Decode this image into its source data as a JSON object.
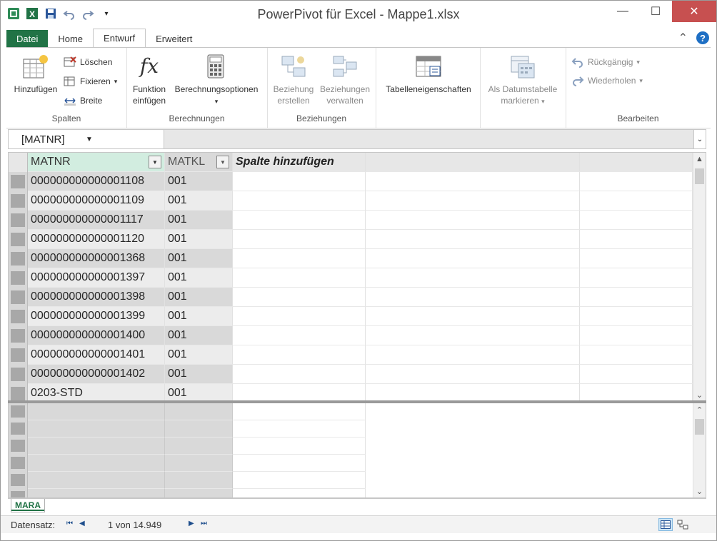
{
  "window": {
    "title": "PowerPivot für Excel - Mappe1.xlsx",
    "minimize": "—",
    "maximize": "☐",
    "close": "✕"
  },
  "ribbon": {
    "tabs": [
      {
        "label": "Datei"
      },
      {
        "label": "Home"
      },
      {
        "label": "Entwurf"
      },
      {
        "label": "Erweitert"
      }
    ],
    "help": "?",
    "collapse": "⌃",
    "groups": {
      "spalten": {
        "label": "Spalten",
        "hinzufuegen": "Hinzufügen",
        "loeschen": "Löschen",
        "fixieren": "Fixieren",
        "breite": "Breite"
      },
      "berechnungen": {
        "label": "Berechnungen",
        "funktion_line1": "Funktion",
        "funktion_line2": "einfügen",
        "optionen": "Berechnungsoptionen"
      },
      "beziehungen": {
        "label": "Beziehungen",
        "erstellen_line1": "Beziehung",
        "erstellen_line2": "erstellen",
        "verwalten_line1": "Beziehungen",
        "verwalten_line2": "verwalten"
      },
      "tabelle": {
        "eigenschaften": "Tabelleneigenschaften"
      },
      "datum": {
        "line1": "Als Datumstabelle",
        "line2": "markieren"
      },
      "bearbeiten": {
        "label": "Bearbeiten",
        "rueckgaengig": "Rückgängig",
        "wiederholen": "Wiederholen"
      }
    }
  },
  "formula_bar": {
    "name_box": "[MATNR]"
  },
  "table": {
    "columns": [
      "MATNR",
      "MATKL",
      "Spalte hinzufügen"
    ],
    "rows": [
      [
        "000000000000001108",
        "001"
      ],
      [
        "000000000000001109",
        "001"
      ],
      [
        "000000000000001117",
        "001"
      ],
      [
        "000000000000001120",
        "001"
      ],
      [
        "000000000000001368",
        "001"
      ],
      [
        "000000000000001397",
        "001"
      ],
      [
        "000000000000001398",
        "001"
      ],
      [
        "000000000000001399",
        "001"
      ],
      [
        "000000000000001400",
        "001"
      ],
      [
        "000000000000001401",
        "001"
      ],
      [
        "000000000000001402",
        "001"
      ],
      [
        "0203-STD",
        "001"
      ]
    ]
  },
  "sheet_tabs": [
    "MARA"
  ],
  "status_bar": {
    "label": "Datensatz:",
    "record": "1 von 14.949"
  }
}
